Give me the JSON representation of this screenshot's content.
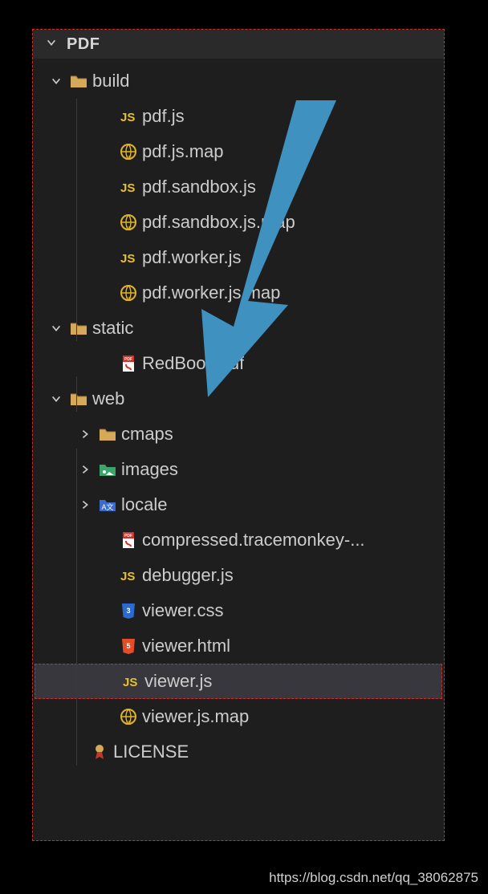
{
  "header": {
    "title": "PDF"
  },
  "tree": {
    "root": "PDF",
    "items": [
      {
        "label": "build",
        "type": "folder-open",
        "chevron": "down",
        "depth": 1
      },
      {
        "label": "pdf.js",
        "type": "js",
        "depth": 2
      },
      {
        "label": "pdf.js.map",
        "type": "map",
        "depth": 2
      },
      {
        "label": "pdf.sandbox.js",
        "type": "js",
        "depth": 2
      },
      {
        "label": "pdf.sandbox.js.map",
        "type": "map",
        "depth": 2
      },
      {
        "label": "pdf.worker.js",
        "type": "js",
        "depth": 2
      },
      {
        "label": "pdf.worker.js.map",
        "type": "map",
        "depth": 2
      },
      {
        "label": "static",
        "type": "folder-open",
        "chevron": "down",
        "depth": 1
      },
      {
        "label": "RedBook.pdf",
        "type": "pdf",
        "depth": 2
      },
      {
        "label": "web",
        "type": "folder-open",
        "chevron": "down",
        "depth": 1
      },
      {
        "label": "cmaps",
        "type": "folder-closed",
        "chevron": "right",
        "depth": 2
      },
      {
        "label": "images",
        "type": "folder-images",
        "chevron": "right",
        "depth": 2
      },
      {
        "label": "locale",
        "type": "folder-locale",
        "chevron": "right",
        "depth": 2
      },
      {
        "label": "compressed.tracemonkey-...",
        "type": "pdf",
        "depth": 2
      },
      {
        "label": "debugger.js",
        "type": "js",
        "depth": 2
      },
      {
        "label": "viewer.css",
        "type": "css",
        "depth": 2
      },
      {
        "label": "viewer.html",
        "type": "html",
        "depth": 2
      },
      {
        "label": "viewer.js",
        "type": "js",
        "depth": 2,
        "selected": true
      },
      {
        "label": "viewer.js.map",
        "type": "map",
        "depth": 2
      },
      {
        "label": "LICENSE",
        "type": "license",
        "depth": 1
      }
    ]
  },
  "footer": {
    "watermark": "https://blog.csdn.net/qq_38062875"
  },
  "colors": {
    "jsYellow": "#e8c12a",
    "mapYellow": "#e0b52a",
    "folder": "#d6a85a",
    "cssBlue": "#2a6bd0",
    "htmlOrange": "#e44d26",
    "pdfRed": "#d0322a",
    "green": "#3aa66a",
    "blueFolder": "#3a6bd0",
    "arrow": "#3f91c0"
  }
}
